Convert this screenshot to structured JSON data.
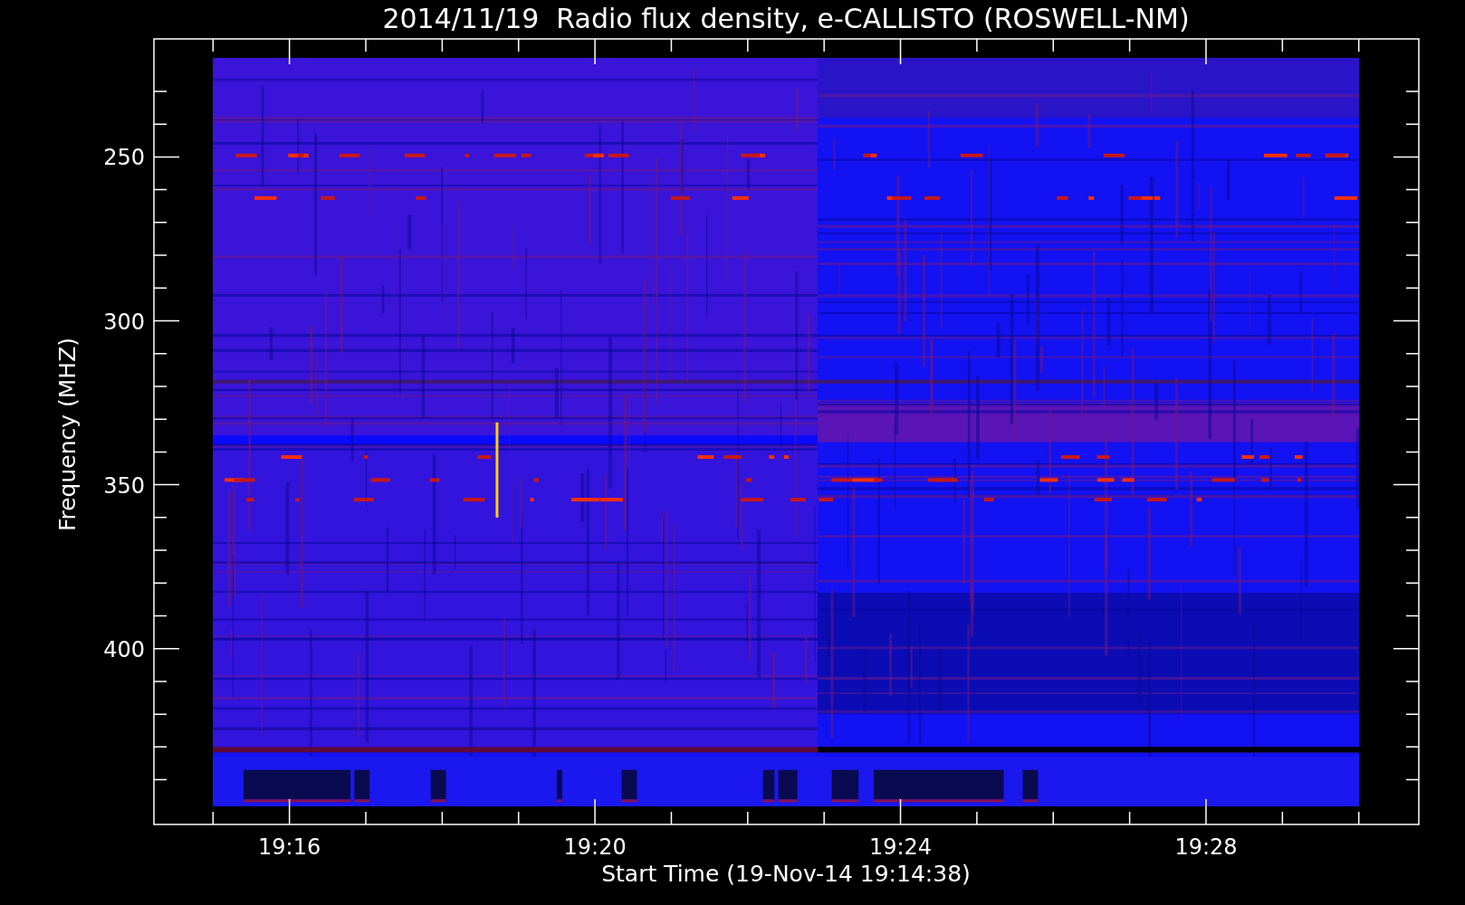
{
  "title": "2014/11/19  Radio flux density, e-CALLISTO (ROSWELL-NM)",
  "x_axis": {
    "label": "Start Time (19-Nov-14 19:14:38)",
    "ticks": [
      "19:16",
      "19:20",
      "19:24",
      "19:28"
    ]
  },
  "y_axis": {
    "label": "Frequency (MHZ)",
    "ticks": [
      "250",
      "300",
      "350",
      "400"
    ]
  }
}
